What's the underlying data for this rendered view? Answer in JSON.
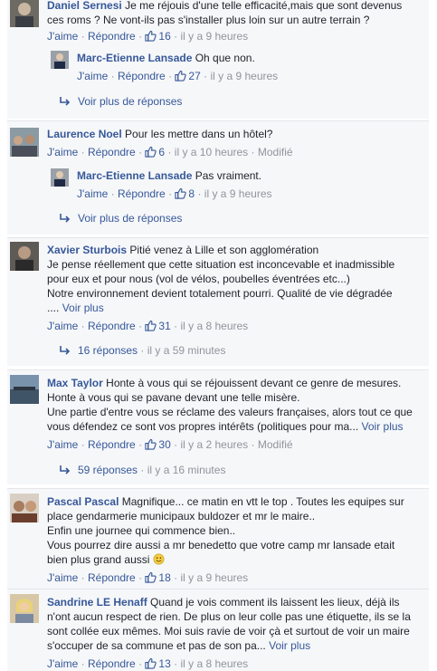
{
  "labels": {
    "like": "J'aime",
    "reply": "Répondre",
    "sep": "·",
    "see_more": "Voir plus"
  },
  "c1": {
    "author": "Daniel Sernesi",
    "line1": "Je me réjouis d'une telle efficacité,mais que sont devenus",
    "line2": "ces roms ? Ne vont-ils pas s'installer plus loin sur un autre terrain ?",
    "likes": "16",
    "time": "il y a 9 heures",
    "reply": {
      "author": "Marc-Etienne Lansade",
      "text": "Oh que non.",
      "likes": "27",
      "time": "il y a 9 heures"
    },
    "more_replies": "Voir plus de réponses"
  },
  "c2": {
    "author": "Laurence Noel",
    "text": "Pour les mettre dans un hôtel?",
    "likes": "6",
    "time": "il y a 10 heures",
    "edited": "Modifié",
    "reply": {
      "author": "Marc-Etienne Lansade",
      "text": "Pas vraiment.",
      "likes": "8",
      "time": "il y a 9 heures"
    },
    "more_replies": "Voir plus de réponses"
  },
  "c3": {
    "author": "Xavier Sturbois",
    "line1": "Pitié venez à Lille et son agglomération",
    "line2": "Je pense réellement que cette situation est inconcevable et inadmissible",
    "line3": "pour eux et pour nous (vol de vélos, poubelles éventrées etc...)",
    "line4": "Notre environnement devient totalement pourri. Qualité de vie dégradée",
    "line5": "....",
    "likes": "31",
    "time": "il y a 8 heures",
    "replies": "16 réponses",
    "replies_time": "il y a 59 minutes"
  },
  "c4": {
    "author": "Max Taylor",
    "line1": "Honte à vous qui se réjouissent devant ce genre de mesures.",
    "line2": "Honte à vous qui se pavane devant une telle misère.",
    "line3": "Une partie d'entre vous se réclame des valeurs françaises, alors tout ce que",
    "line4": "vous défendez ce sont vos propres intérêts (politiques pour ma...",
    "likes": "30",
    "time": "il y a 2 heures",
    "edited": "Modifié",
    "replies": "59 réponses",
    "replies_time": "il y a 16 minutes"
  },
  "c5": {
    "author": "Pascal Pascal",
    "line1": "Magnifique... ce matin en vtt le top . Toutes les equipes sur",
    "line2": "place gendarmerie municipaux buldozer et mr le maire..",
    "line3": "Enfin une journee qui commence bien..",
    "line4": "Vous pourrez dire aussi a mr benedetto que votre camp mr lansade etait",
    "line5": "bien plus grand aussi",
    "likes": "18",
    "time": "il y a 9 heures"
  },
  "c6": {
    "author": "Sandrine LE Henaff",
    "line1": "Quand je vois comment ils laissent les lieux, déjà ils",
    "line2": "n'ont aucun respect de rien. De plus on leur colle pas une étiquette, ils se la",
    "line3": "sont collée eux mêmes. Moi suis ravie de voir çà et surtout de voir un maire",
    "line4": "s'occuper de sa commune et pas de son pa...",
    "likes": "13",
    "time": "il y a 8 heures"
  },
  "colors": {
    "link": "#365899",
    "meta": "#90949c",
    "text": "#1d2129",
    "panel": "#f6f7f9"
  }
}
